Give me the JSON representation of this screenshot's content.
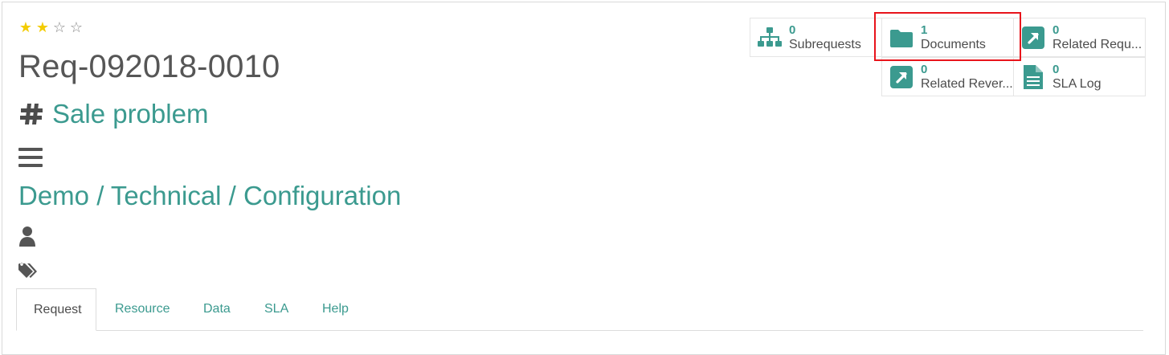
{
  "record": {
    "rating_filled": 2,
    "rating_total": 4,
    "name": "Req-092018-0010",
    "subject": "Sale problem",
    "category": "Demo / Technical / Configuration"
  },
  "buttons": {
    "subrequests": {
      "value": "0",
      "label": "Subrequests",
      "icon": "sitemap-icon"
    },
    "documents": {
      "value": "1",
      "label": "Documents",
      "icon": "folder-icon"
    },
    "related_requests": {
      "value": "0",
      "label": "Related Requ...",
      "icon": "external-link-icon"
    },
    "related_reverse": {
      "value": "0",
      "label": "Related Rever...",
      "icon": "external-link-icon"
    },
    "sla_log": {
      "value": "0",
      "label": "SLA Log",
      "icon": "file-text-icon"
    }
  },
  "tabs": [
    {
      "label": "Request",
      "active": true
    },
    {
      "label": "Resource"
    },
    {
      "label": "Data"
    },
    {
      "label": "SLA"
    },
    {
      "label": "Help"
    }
  ],
  "colors": {
    "accent": "#3b9a8f",
    "star": "#f3cc00",
    "highlight": "#e8141b"
  }
}
